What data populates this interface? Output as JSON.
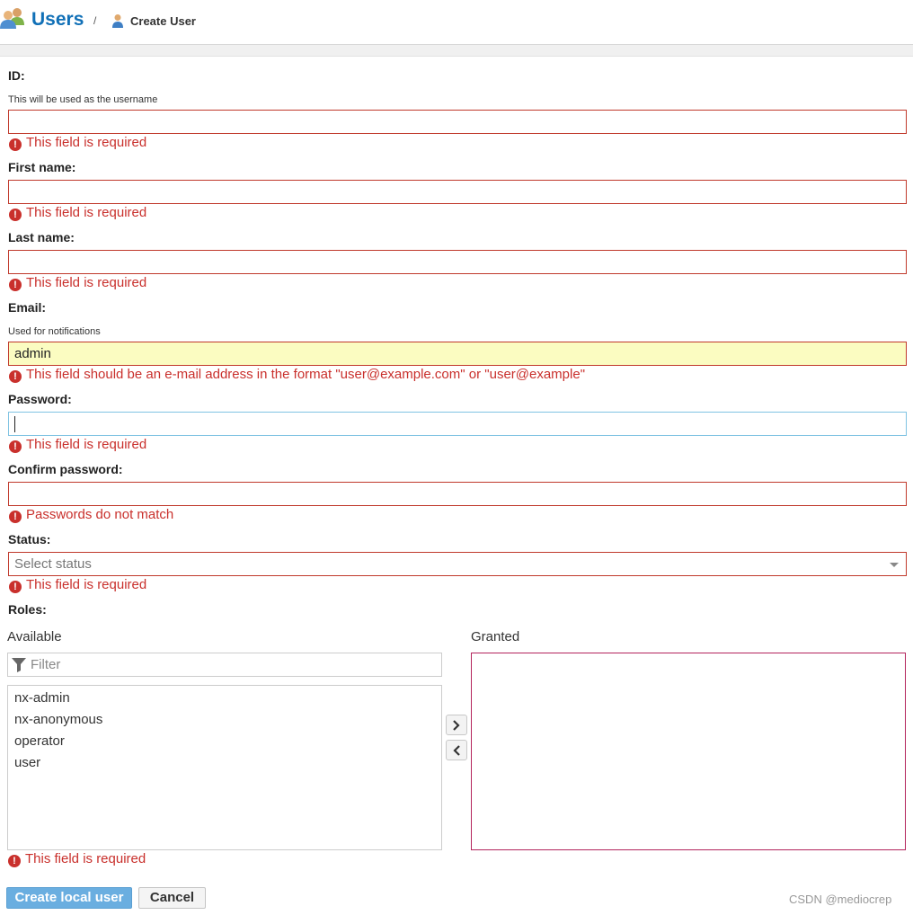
{
  "header": {
    "title": "Users",
    "separator": "/",
    "breadcrumb": "Create User"
  },
  "form": {
    "id": {
      "label": "ID:",
      "help": "This will be used as the username",
      "value": "",
      "error": "This field is required"
    },
    "first_name": {
      "label": "First name:",
      "value": "",
      "error": "This field is required"
    },
    "last_name": {
      "label": "Last name:",
      "value": "",
      "error": "This field is required"
    },
    "email": {
      "label": "Email:",
      "help": "Used for notifications",
      "value": "admin",
      "error": "This field should be an e-mail address in the format \"user@example.com\" or \"user@example\""
    },
    "password": {
      "label": "Password:",
      "value": "",
      "error": "This field is required"
    },
    "confirm_password": {
      "label": "Confirm password:",
      "value": "",
      "error": "Passwords do not match"
    },
    "status": {
      "label": "Status:",
      "placeholder": "Select status",
      "error": "This field is required"
    },
    "roles": {
      "label": "Roles:",
      "available_label": "Available",
      "granted_label": "Granted",
      "filter_placeholder": "Filter",
      "available": [
        "nx-admin",
        "nx-anonymous",
        "operator",
        "user"
      ],
      "granted": [],
      "error": "This field is required"
    }
  },
  "buttons": {
    "create": "Create local user",
    "cancel": "Cancel"
  },
  "watermark": "CSDN @mediocrep",
  "colors": {
    "brand": "#1170b7",
    "error": "#c9302c",
    "primary_button": "#6aaee0",
    "warning_field_bg": "#fbfcc1"
  }
}
